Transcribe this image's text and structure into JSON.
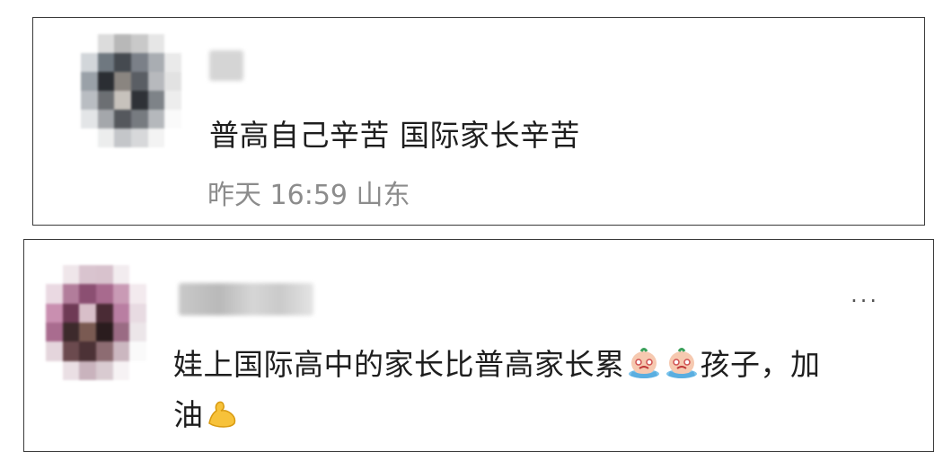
{
  "comments": [
    {
      "text": "普高自己辛苦 国际家长辛苦",
      "time": "昨天 16:59",
      "location": "山东"
    },
    {
      "text_line1": "娃上国际高中的家长比普高家长累",
      "text_line1_tail": "孩子，加",
      "text_line2": "油",
      "more_label": "···",
      "emoji_icons": [
        "crying-face-icon",
        "crying-face-icon",
        "flexed-biceps-icon"
      ]
    }
  ]
}
